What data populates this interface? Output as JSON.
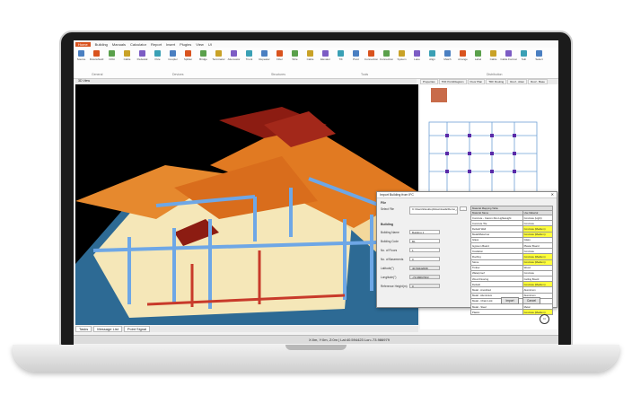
{
  "menu": {
    "file": "Home",
    "items": [
      "Building",
      "Manuals",
      "Calculator",
      "Report",
      "Insert",
      "Plugins",
      "View",
      "UI"
    ]
  },
  "ribbon": {
    "buttons": [
      "Source",
      "Downshield",
      "Orbit",
      "Cable",
      "Pedestal",
      "Pole",
      "Coupler",
      "Splitter",
      "Bridge",
      "Terminator",
      "Attenuator",
      "Trunk",
      "Repeater",
      "Fiber",
      "Wire",
      "Cable",
      "Elevator",
      "Tilt",
      "Pivot",
      "Connection",
      "Connection",
      "System",
      "Lane",
      "Align",
      "Match",
      "Arrange",
      "Label",
      "Cable",
      "Cable Format",
      "Sub",
      "Select"
    ],
    "groups": [
      "General",
      "Devices",
      "Structures",
      "Tools",
      "Distribution"
    ],
    "colors": {
      "accent": "#d9531e"
    }
  },
  "view": {
    "tab": "3D View"
  },
  "right_tabs": [
    "Properties",
    "TDF PointDiagram",
    "Floor Plan",
    "TDF Routing",
    "Roof - Atten",
    "Roof - Base"
  ],
  "dialog": {
    "title": "Import Building from IFC",
    "file_section": "File",
    "select_file_label": "Select File",
    "file_path": "C:\\Users\\Desktop\\Downloads\\Demo_Architectural.ifc",
    "building_section": "Building",
    "fields": [
      {
        "label": "Building Name",
        "value": "Building 1"
      },
      {
        "label": "Building Code",
        "value": "B1"
      },
      {
        "label": "No. of Floors",
        "value": "1"
      },
      {
        "label": "No. of Basements",
        "value": "0"
      },
      {
        "label": "Latitude(°)",
        "value": "40.59442098"
      },
      {
        "label": "Longitude(°)",
        "value": "-73.98697963"
      },
      {
        "label": "Reference Height(m)",
        "value": "0"
      }
    ],
    "table_title": "Material Mapping Table",
    "table_headers": [
      "Material Name",
      "Use Material"
    ],
    "table_rows": [
      {
        "name": "Concrete - Cast-in-Situ Lightweight",
        "use": "Concrete (Light)",
        "hl": false
      },
      {
        "name": "Concrete Tile",
        "use": "Concrete",
        "hl": false
      },
      {
        "name": "Default Wall",
        "use": "Concrete (Medium)",
        "hl": true
      },
      {
        "name": "Metal/Metal Lar",
        "use": "Concrete (Medium)",
        "hl": true
      },
      {
        "name": "Glass",
        "use": "Glass",
        "hl": false
      },
      {
        "name": "Gypsum Board",
        "use": "Plaster Board",
        "hl": false
      },
      {
        "name": "Insulation",
        "use": "Concrete",
        "hl": false
      },
      {
        "name": "Roofing",
        "use": "Concrete (Medium)",
        "hl": true
      },
      {
        "name": "Stone",
        "use": "Concrete (Medium)",
        "hl": true
      },
      {
        "name": "Timber",
        "use": "Wood",
        "hl": false
      },
      {
        "name": "Waterproof",
        "use": "Concrete",
        "hl": false
      },
      {
        "name": "Wood Flooring",
        "use": "Ceiling Board",
        "hl": false
      },
      {
        "name": "Default",
        "use": "Concrete (Medium)",
        "hl": true
      },
      {
        "name": "Metal - Anodized",
        "use": "Aluminium",
        "hl": false
      },
      {
        "name": "Metal - Aluminium",
        "use": "Aluminium",
        "hl": false
      },
      {
        "name": "Metal - Chain Link",
        "use": "Metal",
        "hl": false
      },
      {
        "name": "Metal - Steel",
        "use": "Metal",
        "hl": false
      },
      {
        "name": "Plastic",
        "use": "Concrete (Medium)",
        "hl": true
      }
    ],
    "import_button": "Import",
    "cancel_button": "Cancel"
  },
  "bottom_tabs": [
    "Tasks",
    "Message List",
    "Point Signal"
  ],
  "status": {
    "coords": "X:0m, Y:0m, Z:0m | Lat:40.594423 Lon:-73.986979"
  }
}
